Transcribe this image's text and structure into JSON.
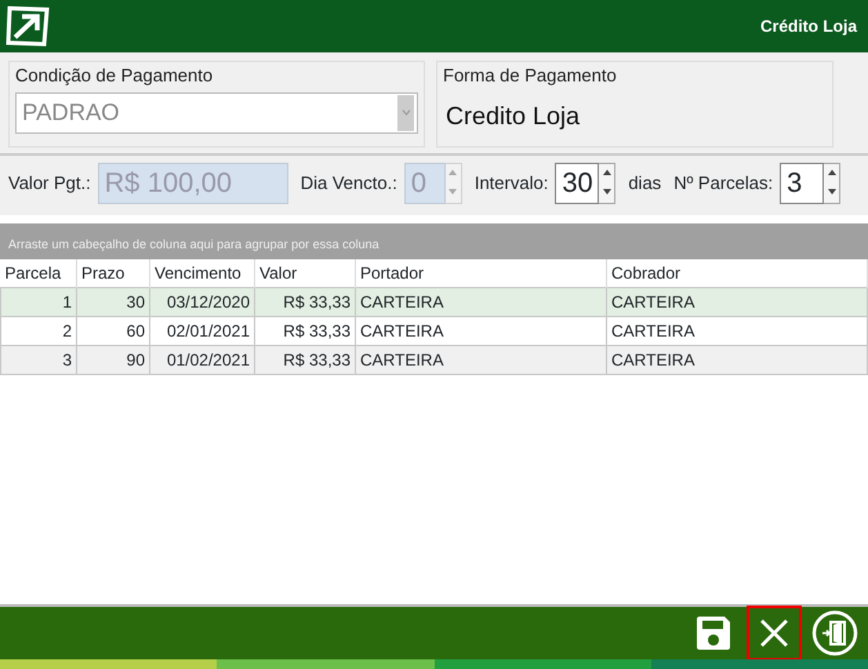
{
  "window": {
    "title": "Crédito Loja"
  },
  "condicao": {
    "label": "Condição de Pagamento",
    "value": "PADRAO",
    "disabled": true
  },
  "forma": {
    "label": "Forma de Pagamento",
    "value": "Credito Loja"
  },
  "fields": [
    {
      "kind": "text",
      "label": "Valor Pgt.:",
      "value": "R$ 100,00",
      "disabled": true
    },
    {
      "kind": "spin",
      "label": "Dia Vencto.:",
      "value": "0",
      "disabled": true
    },
    {
      "kind": "spin",
      "label": "Intervalo:",
      "value": "30",
      "disabled": false,
      "suffix": "dias"
    },
    {
      "kind": "spin",
      "label": "Nº Parcelas:",
      "value": "3",
      "disabled": false
    }
  ],
  "group_hint": "Arraste um cabeçalho de coluna aqui para agrupar por essa coluna",
  "table": {
    "columns": [
      "Parcela",
      "Prazo",
      "Vencimento",
      "Valor",
      "Portador",
      "Cobrador"
    ],
    "rows": [
      {
        "cells": [
          "1",
          "30",
          "03/12/2020",
          "R$ 33,33",
          "CARTEIRA",
          "CARTEIRA"
        ],
        "selected": true
      },
      {
        "cells": [
          "2",
          "60",
          "02/01/2021",
          "R$ 33,33",
          "CARTEIRA",
          "CARTEIRA"
        ],
        "selected": false
      },
      {
        "cells": [
          "3",
          "90",
          "01/02/2021",
          "R$ 33,33",
          "CARTEIRA",
          "CARTEIRA"
        ],
        "selected": false
      }
    ]
  },
  "footer_buttons": [
    {
      "kind": "save",
      "focused": false
    },
    {
      "kind": "cancel",
      "focused": true
    },
    {
      "kind": "exit",
      "focused": false
    }
  ]
}
